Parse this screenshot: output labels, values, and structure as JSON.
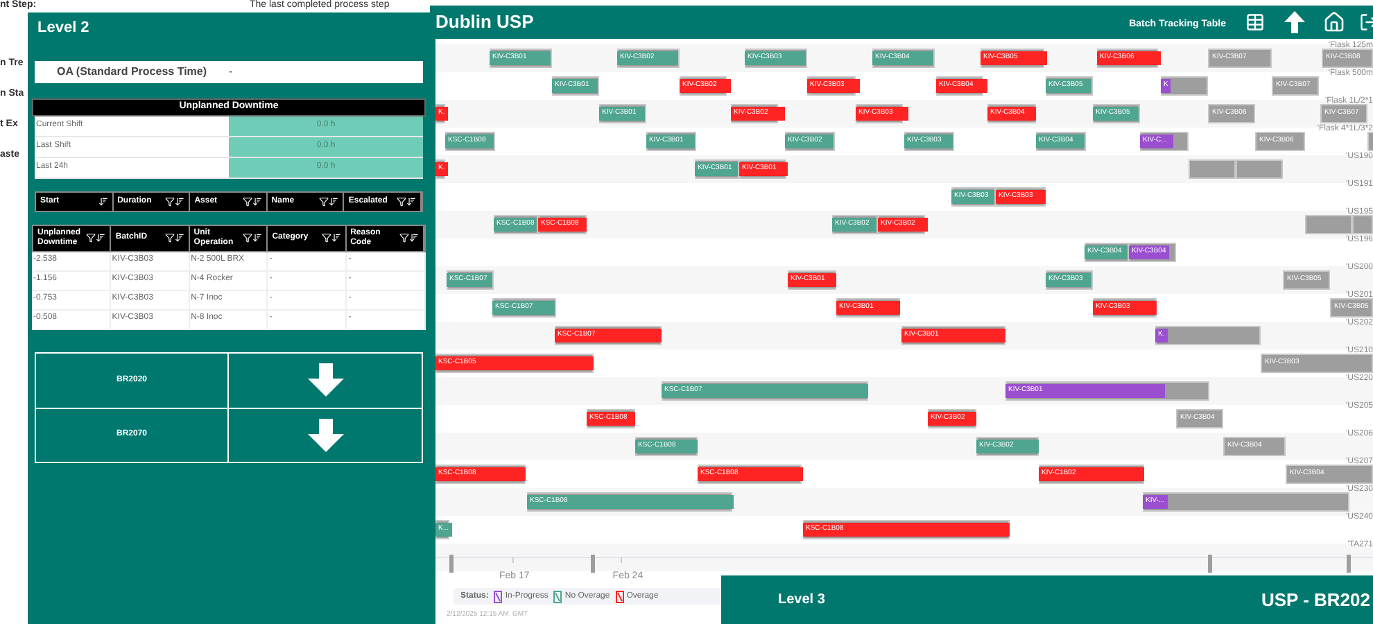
{
  "background_page": {
    "top_text": "The last completed process step",
    "side_texts": [
      "nt Step:",
      "n Tre",
      "n Sta",
      "t Ex",
      "aste"
    ]
  },
  "level2": {
    "title": "Level 2",
    "oa": {
      "label": "OA (Standard Process Time)",
      "value": "-"
    },
    "downtime": {
      "title": "Unplanned Downtime",
      "rows": [
        {
          "label": "Current Shift",
          "value": "0.0 h"
        },
        {
          "label": "Last Shift",
          "value": "0.0 h"
        },
        {
          "label": "Last 24h",
          "value": "0.0 h"
        }
      ]
    },
    "events_table": {
      "columns": [
        {
          "label": "Start",
          "filter": false
        },
        {
          "label": "Duration",
          "filter": true
        },
        {
          "label": "Asset",
          "filter": true
        },
        {
          "label": "Name",
          "filter": true
        },
        {
          "label": "Escalated",
          "filter": true
        }
      ]
    },
    "downtime_table": {
      "columns": [
        "Unplanned Downtime",
        "BatchID",
        "Unit Operation",
        "Category",
        "Reason Code"
      ],
      "rows": [
        [
          "-2.538",
          "KIV-C3B03",
          "N-2 500L BRX",
          "-",
          "-"
        ],
        [
          "-1.156",
          "KIV-C3B03",
          "N-4 Rocker",
          "-",
          "-"
        ],
        [
          "-0.753",
          "KIV-C3B03",
          "N-7 Inoc",
          "-",
          "-"
        ],
        [
          "-0.508",
          "KIV-C3B03",
          "N-8 Inoc",
          "-",
          "-"
        ]
      ]
    },
    "batches": [
      {
        "label": "BR2020"
      },
      {
        "label": "BR2070"
      }
    ]
  },
  "dublin": {
    "title": "Dublin USP",
    "link": "Batch Tracking Table",
    "gantt": {
      "rows": [
        {
          "name": "'Flask 125m",
          "bars": [
            {
              "label": "KIV-C3B01",
              "kind": "no_overage"
            },
            {
              "label": "KIV-C3B02",
              "kind": "no_overage"
            },
            {
              "label": "KIV-C3B03",
              "kind": "no_overage"
            },
            {
              "label": "KIV-C3B04",
              "kind": "no_overage"
            },
            {
              "label": "KIV-C3B05",
              "kind": "overage"
            },
            {
              "label": "KIV-C3B06",
              "kind": "overage"
            },
            {
              "label": "KIV-C3B07",
              "kind": "planned"
            },
            {
              "label": "KIV-C3B08",
              "kind": "planned"
            }
          ]
        },
        {
          "name": "'Flask 500m",
          "bars": [
            {
              "label": "KIV-C3B01",
              "kind": "no_overage"
            },
            {
              "label": "KIV-C3B02",
              "kind": "overage"
            },
            {
              "label": "KIV-C3B03",
              "kind": "overage"
            },
            {
              "label": "KIV-C3B04",
              "kind": "overage"
            },
            {
              "label": "KIV-C3B05",
              "kind": "no_overage"
            },
            {
              "label": "K",
              "kind": "in_progress"
            },
            {
              "label": "KIV-C3B07",
              "kind": "planned"
            }
          ]
        },
        {
          "name": "'Flask 1L/2*1",
          "bars": [
            {
              "label": "K.",
              "kind": "overage"
            },
            {
              "label": "KIV-C3B01",
              "kind": "no_overage"
            },
            {
              "label": "KIV-C3B02",
              "kind": "overage"
            },
            {
              "label": "KIV-C3B03",
              "kind": "overage"
            },
            {
              "label": "KIV-C3B04",
              "kind": "overage"
            },
            {
              "label": "KIV-C3B05",
              "kind": "no_overage"
            },
            {
              "label": "KIV-C3B06",
              "kind": "planned"
            },
            {
              "label": "KIV-C3B07",
              "kind": "planned"
            }
          ]
        },
        {
          "name": "'Flask 4*1L/3*2",
          "bars": [
            {
              "label": "KSC-C1B08",
              "kind": "no_overage"
            },
            {
              "label": "KIV-C3B01",
              "kind": "no_overage"
            },
            {
              "label": "KIV-C3B02",
              "kind": "no_overage"
            },
            {
              "label": "KIV-C3B03",
              "kind": "no_overage"
            },
            {
              "label": "KIV-C3B04",
              "kind": "no_overage"
            },
            {
              "label": "KIV-C...",
              "kind": "in_progress"
            },
            {
              "label": "KIV-C3B06",
              "kind": "planned"
            },
            {
              "kind": "planned"
            }
          ]
        },
        {
          "name": "'US190",
          "bars": [
            {
              "label": "K.",
              "kind": "overage"
            },
            {
              "label": "KIV-C3B01",
              "kind": "no_overage"
            },
            {
              "label": "KIV-C3B01",
              "kind": "overage"
            },
            {
              "kind": "planned"
            },
            {
              "kind": "planned"
            }
          ]
        },
        {
          "name": "'US191",
          "bars": [
            {
              "label": "KIV-C3B03",
              "kind": "no_overage"
            },
            {
              "label": "KIV-C3B03",
              "kind": "overage"
            }
          ]
        },
        {
          "name": "'US195",
          "bars": [
            {
              "label": "KSC-C1B08",
              "kind": "no_overage"
            },
            {
              "label": "KSC-C1B08",
              "kind": "overage"
            },
            {
              "label": "KIV-C3B02",
              "kind": "no_overage"
            },
            {
              "label": "KIV-C3B02",
              "kind": "overage"
            },
            {
              "kind": "planned"
            },
            {
              "kind": "planned"
            }
          ]
        },
        {
          "name": "'US196",
          "bars": [
            {
              "label": "KIV-C3B04",
              "kind": "no_overage"
            },
            {
              "label": "KIV-C3B04",
              "kind": "in_progress"
            }
          ]
        },
        {
          "name": "'US200",
          "bars": [
            {
              "label": "KSC-C1B07",
              "kind": "no_overage"
            },
            {
              "label": "KIV-C3B01",
              "kind": "overage"
            },
            {
              "label": "KIV-C3B03",
              "kind": "no_overage"
            },
            {
              "label": "KIV-C3B05",
              "kind": "planned"
            }
          ]
        },
        {
          "name": "'US201",
          "bars": [
            {
              "label": "KSC-C1B07",
              "kind": "no_overage"
            },
            {
              "label": "KIV-C3B01",
              "kind": "overage"
            },
            {
              "label": "KIV-C3B03",
              "kind": "overage"
            },
            {
              "label": "KIV-C3B05",
              "kind": "planned"
            }
          ]
        },
        {
          "name": "'US202",
          "bars": [
            {
              "label": "KSC-C1B07",
              "kind": "overage"
            },
            {
              "label": "KIV-C3B01",
              "kind": "overage"
            },
            {
              "label": "K.",
              "kind": "in_progress"
            }
          ]
        },
        {
          "name": "'US210",
          "bars": [
            {
              "label": "KSC-C1B05",
              "kind": "overage"
            },
            {
              "label": "KIV-C3B03",
              "kind": "planned"
            }
          ]
        },
        {
          "name": "'US220",
          "bars": [
            {
              "label": "KSC-C1B07",
              "kind": "no_overage"
            },
            {
              "label": "KIV-C3B01",
              "kind": "in_progress"
            }
          ]
        },
        {
          "name": "'US205",
          "bars": [
            {
              "label": "KSC-C1B08",
              "kind": "overage"
            },
            {
              "label": "KIV-C3B02",
              "kind": "overage"
            },
            {
              "label": "KIV-C3B04",
              "kind": "planned"
            }
          ]
        },
        {
          "name": "'US206",
          "bars": [
            {
              "label": "KSC-C1B08",
              "kind": "no_overage"
            },
            {
              "label": "KIV-C3B02",
              "kind": "no_overage"
            },
            {
              "label": "KIV-C3B04",
              "kind": "planned"
            }
          ]
        },
        {
          "name": "'US207",
          "bars": [
            {
              "label": "KSC-C1B08",
              "kind": "overage"
            },
            {
              "label": "KSC-C1B08",
              "kind": "overage"
            },
            {
              "label": "KIV-C1B02",
              "kind": "overage"
            },
            {
              "label": "KIV-C3B04",
              "kind": "planned"
            }
          ]
        },
        {
          "name": "'US230",
          "bars": [
            {
              "label": "KSC-C1B08",
              "kind": "no_overage"
            },
            {
              "label": "KIV-...",
              "kind": "in_progress"
            }
          ]
        },
        {
          "name": "'US240",
          "bars": [
            {
              "label": "K...",
              "kind": "no_overage"
            },
            {
              "label": "KSC-C1B08",
              "kind": "overage"
            }
          ]
        },
        {
          "name": "'TA271"
        }
      ],
      "axis_labels": [
        "Feb 17",
        "Feb 24"
      ],
      "legend": {
        "title": "Status:",
        "items": [
          {
            "label": "In-Progress",
            "kind": "in_progress"
          },
          {
            "label": "No Overage",
            "kind": "no_overage"
          },
          {
            "label": "Overage",
            "kind": "overage"
          }
        ]
      },
      "timestamp": "2/12/2025 12:15 AM  GMT"
    }
  },
  "level3": {
    "title": "Level 3",
    "subtitle": "USP - BR202"
  }
}
